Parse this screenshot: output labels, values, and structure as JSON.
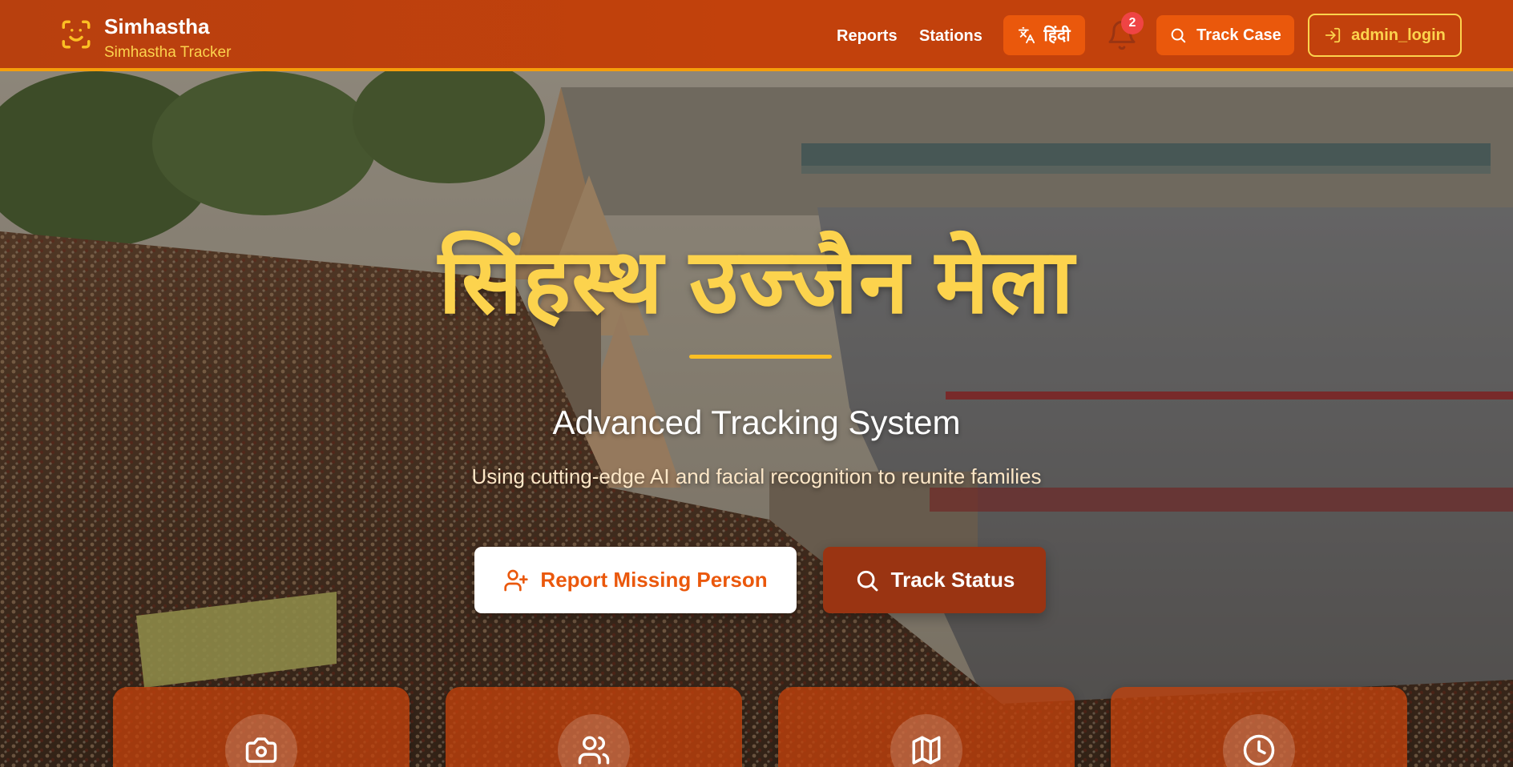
{
  "header": {
    "brand_title": "Simhastha",
    "brand_subtitle": "Simhastha Tracker",
    "nav": {
      "reports": "Reports",
      "stations": "Stations"
    },
    "language_label": "हिंदी",
    "notification_count": "2",
    "track_case_label": "Track Case",
    "login_label": "admin_login"
  },
  "hero": {
    "title": "सिंहस्थ उज्जैन मेला",
    "subtitle": "Advanced Tracking System",
    "description": "Using cutting-edge AI and facial recognition to reunite families",
    "report_button": "Report Missing Person",
    "track_button": "Track Status"
  },
  "feature_cards": [
    {
      "icon": "camera-icon"
    },
    {
      "icon": "users-icon"
    },
    {
      "icon": "map-icon"
    },
    {
      "icon": "clock-icon"
    }
  ],
  "colors": {
    "header_bg": "#c2410c",
    "accent_yellow": "#fcd34d",
    "button_orange": "#ea580c",
    "button_dark": "#9a3412"
  }
}
